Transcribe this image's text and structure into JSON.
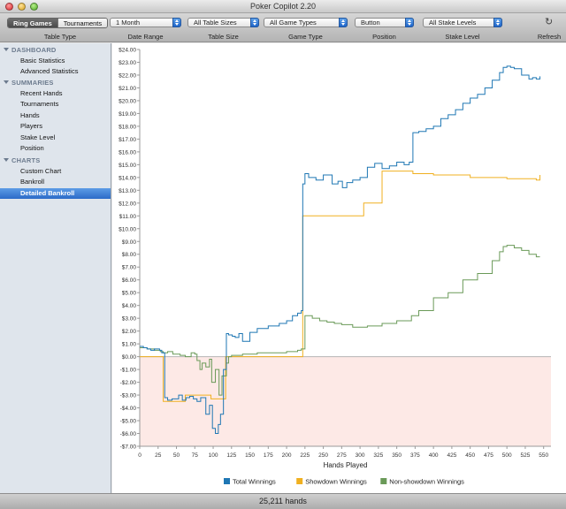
{
  "window": {
    "title": "Poker Copilot 2.20"
  },
  "toolbar": {
    "segments": [
      "Ring Games",
      "Tournaments"
    ],
    "filters": [
      {
        "value": "1 Month",
        "label": "Date Range"
      },
      {
        "value": "All Table Sizes",
        "label": "Table Size"
      },
      {
        "value": "All Game Types",
        "label": "Game Type"
      },
      {
        "value": "Button",
        "label": "Position"
      },
      {
        "value": "All Stake Levels",
        "label": "Stake Level"
      }
    ],
    "table_type_label": "Table Type",
    "refresh_label": "Refresh",
    "refresh_icon": "refresh-icon"
  },
  "sidebar": {
    "sections": [
      {
        "title": "DASHBOARD",
        "items": [
          "Basic Statistics",
          "Advanced Statistics"
        ]
      },
      {
        "title": "SUMMARIES",
        "items": [
          "Recent Hands",
          "Tournaments",
          "Hands",
          "Players",
          "Stake Level",
          "Position"
        ]
      },
      {
        "title": "CHARTS",
        "items": [
          "Custom Chart",
          "Bankroll",
          "Detailed Bankroll"
        ]
      }
    ],
    "selected": "Detailed Bankroll"
  },
  "status": {
    "text": "25,211 hands"
  },
  "colors": {
    "total": "#1f77b4",
    "showdown": "#f0b020",
    "non_showdown": "#6a9a58",
    "negative_band": "#fde9e6",
    "accent": "#2b6bc8"
  },
  "chart_data": {
    "type": "line",
    "title": "",
    "xlabel": "Hands Played",
    "ylabel": "",
    "xlim": [
      0,
      560
    ],
    "ylim": [
      -7,
      24
    ],
    "x_ticks": [
      0,
      25,
      50,
      75,
      100,
      125,
      150,
      175,
      200,
      225,
      250,
      275,
      300,
      325,
      350,
      375,
      400,
      425,
      450,
      475,
      500,
      525,
      550
    ],
    "y_ticks": [
      -7,
      -6,
      -5,
      -4,
      -3,
      -2,
      -1,
      0,
      1,
      2,
      3,
      4,
      5,
      6,
      7,
      8,
      9,
      10,
      11,
      12,
      13,
      14,
      15,
      16,
      17,
      18,
      19,
      20,
      21,
      22,
      23,
      24
    ],
    "y_tick_labels": [
      "-$7.00",
      "-$6.00",
      "-$5.00",
      "-$4.00",
      "-$3.00",
      "-$2.00",
      "-$1.00",
      "$0.00",
      "$1.00",
      "$2.00",
      "$3.00",
      "$4.00",
      "$5.00",
      "$6.00",
      "$7.00",
      "$8.00",
      "$9.00",
      "$10.00",
      "$11.00",
      "$12.00",
      "$13.00",
      "$14.00",
      "$15.00",
      "$16.00",
      "$17.00",
      "$18.00",
      "$19.00",
      "$20.00",
      "$21.00",
      "$22.00",
      "$23.00",
      "$24.00"
    ],
    "legend_position": "bottom",
    "series": [
      {
        "name": "Total Winnings",
        "x": [
          0,
          5,
          10,
          15,
          20,
          24,
          27,
          30,
          34,
          38,
          44,
          48,
          53,
          58,
          63,
          68,
          73,
          78,
          83,
          90,
          95,
          99,
          103,
          107,
          110,
          114,
          118,
          121,
          126,
          130,
          135,
          140,
          150,
          160,
          175,
          190,
          200,
          208,
          215,
          220,
          222,
          225,
          230,
          240,
          250,
          262,
          270,
          276,
          282,
          290,
          300,
          310,
          320,
          330,
          340,
          350,
          360,
          367,
          372,
          380,
          390,
          400,
          410,
          420,
          430,
          440,
          450,
          460,
          470,
          480,
          490,
          495,
          500,
          505,
          510,
          520,
          530,
          535,
          540,
          545
        ],
        "values": [
          0.8,
          0.7,
          0.6,
          0.5,
          0.6,
          0.6,
          0.5,
          0.3,
          -3.2,
          -3.4,
          -3.3,
          -3.3,
          -3.0,
          -3.4,
          -3.2,
          -3.1,
          -3.3,
          -3.5,
          -3.2,
          -4.5,
          -3.8,
          -5.6,
          -6.0,
          -5.3,
          -4.5,
          -1.0,
          1.8,
          1.7,
          1.6,
          1.5,
          1.8,
          1.2,
          1.9,
          2.2,
          2.4,
          2.6,
          2.8,
          3.2,
          3.4,
          3.6,
          13.5,
          14.3,
          14.0,
          13.8,
          14.2,
          13.5,
          13.7,
          13.2,
          13.6,
          13.8,
          14.0,
          14.8,
          15.1,
          14.7,
          14.9,
          15.2,
          15.0,
          15.2,
          17.5,
          17.6,
          17.8,
          18.0,
          18.6,
          18.9,
          19.3,
          19.8,
          20.2,
          20.5,
          21.0,
          21.6,
          22.2,
          22.6,
          22.7,
          22.6,
          22.5,
          22.0,
          21.7,
          21.8,
          21.7,
          21.9
        ]
      },
      {
        "name": "Showdown Winnings",
        "x": [
          0,
          30,
          32,
          60,
          62,
          95,
          97,
          115,
          117,
          200,
          220,
          222,
          300,
          305,
          325,
          330,
          370,
          372,
          400,
          450,
          500,
          540,
          545
        ],
        "values": [
          0.0,
          0.0,
          -3.5,
          -3.5,
          -3.0,
          -3.0,
          -3.3,
          -3.3,
          0.0,
          0.0,
          0.0,
          11.0,
          11.0,
          12.0,
          12.0,
          14.5,
          14.5,
          14.3,
          14.2,
          14.0,
          13.9,
          13.8,
          14.2
        ]
      },
      {
        "name": "Non-showdown Winnings",
        "x": [
          0,
          10,
          20,
          28,
          32,
          38,
          45,
          55,
          62,
          70,
          75,
          78,
          82,
          85,
          90,
          95,
          98,
          103,
          108,
          112,
          118,
          121,
          125,
          140,
          160,
          180,
          200,
          215,
          220,
          225,
          235,
          245,
          255,
          265,
          275,
          290,
          310,
          330,
          350,
          370,
          380,
          400,
          420,
          440,
          460,
          480,
          490,
          495,
          500,
          510,
          520,
          530,
          540,
          545
        ],
        "values": [
          0.7,
          0.6,
          0.5,
          0.4,
          0.3,
          0.4,
          0.2,
          0.1,
          0.0,
          0.3,
          0.2,
          -0.3,
          -1.0,
          -0.5,
          -0.8,
          -0.2,
          -2.0,
          -1.0,
          -3.0,
          -1.5,
          -0.5,
          0.0,
          0.1,
          0.2,
          0.3,
          0.3,
          0.4,
          0.5,
          0.6,
          3.2,
          3.0,
          2.8,
          2.7,
          2.6,
          2.5,
          2.3,
          2.4,
          2.6,
          2.8,
          3.2,
          3.6,
          4.6,
          5.0,
          6.0,
          6.5,
          7.5,
          8.2,
          8.6,
          8.7,
          8.5,
          8.3,
          8.0,
          7.8,
          7.8
        ]
      }
    ]
  }
}
